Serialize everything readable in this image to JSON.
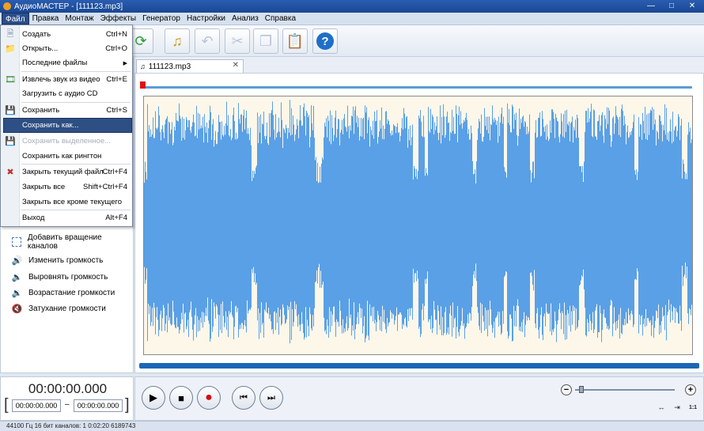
{
  "window": {
    "title": "АудиоМАСТЕР - [111123.mp3]"
  },
  "menubar": {
    "items": [
      "Файл",
      "Правка",
      "Монтаж",
      "Эффекты",
      "Генератор",
      "Настройки",
      "Анализ",
      "Справка"
    ]
  },
  "file_menu": {
    "items": [
      {
        "label": "Создать",
        "shortcut": "Ctrl+N",
        "icon": "new-file-icon",
        "disabled": false
      },
      {
        "label": "Открыть...",
        "shortcut": "Ctrl+O",
        "icon": "folder-icon",
        "disabled": false
      },
      {
        "label": "Последние файлы",
        "shortcut": "",
        "icon": "",
        "submenu": true,
        "disabled": false
      },
      {
        "label": "Извлечь звук из видео",
        "shortcut": "Ctrl+E",
        "icon": "video-extract-icon",
        "disabled": false
      },
      {
        "label": "Загрузить с аудио CD",
        "shortcut": "",
        "icon": "",
        "disabled": false
      },
      {
        "label": "Сохранить",
        "shortcut": "Ctrl+S",
        "icon": "save-icon",
        "disabled": false
      },
      {
        "label": "Сохранить как...",
        "shortcut": "",
        "icon": "",
        "highlighted": true,
        "disabled": false
      },
      {
        "label": "Сохранить выделенное...",
        "shortcut": "",
        "icon": "save-selection-icon",
        "disabled": true
      },
      {
        "label": "Сохранить как рингтон",
        "shortcut": "",
        "icon": "",
        "disabled": false
      },
      {
        "label": "Закрыть текущий файл",
        "shortcut": "Ctrl+F4",
        "icon": "close-file-icon",
        "disabled": false
      },
      {
        "label": "Закрыть все",
        "shortcut": "Shift+Ctrl+F4",
        "icon": "",
        "disabled": false
      },
      {
        "label": "Закрыть все кроме текущего",
        "shortcut": "",
        "icon": "",
        "disabled": false
      },
      {
        "label": "Выход",
        "shortcut": "Alt+F4",
        "icon": "",
        "disabled": false
      }
    ]
  },
  "left_panel": {
    "items": [
      {
        "label": "Добавить вращение каналов",
        "icon": "rotate-channels-icon"
      },
      {
        "label": "Изменить громкость",
        "icon": "volume-change-icon"
      },
      {
        "label": "Выровнять громкость",
        "icon": "volume-normalize-icon"
      },
      {
        "label": "Возрастание громкости",
        "icon": "fade-in-icon"
      },
      {
        "label": "Затухание громкости",
        "icon": "fade-out-icon"
      }
    ]
  },
  "time": {
    "current": "00:00:00.000",
    "start": "00:00:00.000",
    "separator": "–",
    "end": "00:00:00.000"
  },
  "tab": {
    "label": "111123.mp3"
  },
  "colors": {
    "waveform": "#5aa0e6",
    "wave_bg": "#fdf7ea",
    "scroll": "#1b67b5",
    "highlight": "#2e4f84"
  },
  "status": {
    "text": "44100 Гц  16 бит  каналов: 1  0:02:20 6189743"
  }
}
